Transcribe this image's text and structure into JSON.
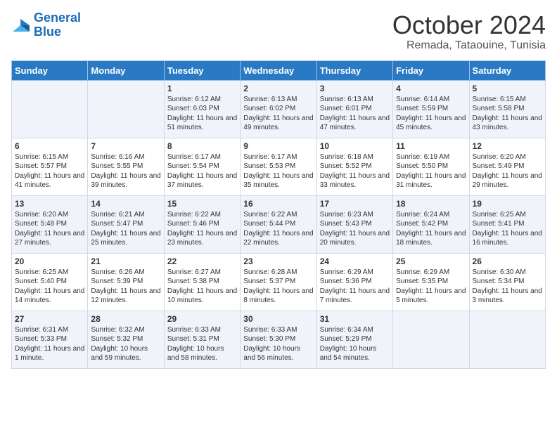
{
  "header": {
    "logo_line1": "General",
    "logo_line2": "Blue",
    "month": "October 2024",
    "location": "Remada, Tataouine, Tunisia"
  },
  "days_of_week": [
    "Sunday",
    "Monday",
    "Tuesday",
    "Wednesday",
    "Thursday",
    "Friday",
    "Saturday"
  ],
  "weeks": [
    [
      {
        "day": "",
        "content": ""
      },
      {
        "day": "",
        "content": ""
      },
      {
        "day": "1",
        "content": "Sunrise: 6:12 AM\nSunset: 6:03 PM\nDaylight: 11 hours and 51 minutes."
      },
      {
        "day": "2",
        "content": "Sunrise: 6:13 AM\nSunset: 6:02 PM\nDaylight: 11 hours and 49 minutes."
      },
      {
        "day": "3",
        "content": "Sunrise: 6:13 AM\nSunset: 6:01 PM\nDaylight: 11 hours and 47 minutes."
      },
      {
        "day": "4",
        "content": "Sunrise: 6:14 AM\nSunset: 5:59 PM\nDaylight: 11 hours and 45 minutes."
      },
      {
        "day": "5",
        "content": "Sunrise: 6:15 AM\nSunset: 5:58 PM\nDaylight: 11 hours and 43 minutes."
      }
    ],
    [
      {
        "day": "6",
        "content": "Sunrise: 6:15 AM\nSunset: 5:57 PM\nDaylight: 11 hours and 41 minutes."
      },
      {
        "day": "7",
        "content": "Sunrise: 6:16 AM\nSunset: 5:55 PM\nDaylight: 11 hours and 39 minutes."
      },
      {
        "day": "8",
        "content": "Sunrise: 6:17 AM\nSunset: 5:54 PM\nDaylight: 11 hours and 37 minutes."
      },
      {
        "day": "9",
        "content": "Sunrise: 6:17 AM\nSunset: 5:53 PM\nDaylight: 11 hours and 35 minutes."
      },
      {
        "day": "10",
        "content": "Sunrise: 6:18 AM\nSunset: 5:52 PM\nDaylight: 11 hours and 33 minutes."
      },
      {
        "day": "11",
        "content": "Sunrise: 6:19 AM\nSunset: 5:50 PM\nDaylight: 11 hours and 31 minutes."
      },
      {
        "day": "12",
        "content": "Sunrise: 6:20 AM\nSunset: 5:49 PM\nDaylight: 11 hours and 29 minutes."
      }
    ],
    [
      {
        "day": "13",
        "content": "Sunrise: 6:20 AM\nSunset: 5:48 PM\nDaylight: 11 hours and 27 minutes."
      },
      {
        "day": "14",
        "content": "Sunrise: 6:21 AM\nSunset: 5:47 PM\nDaylight: 11 hours and 25 minutes."
      },
      {
        "day": "15",
        "content": "Sunrise: 6:22 AM\nSunset: 5:46 PM\nDaylight: 11 hours and 23 minutes."
      },
      {
        "day": "16",
        "content": "Sunrise: 6:22 AM\nSunset: 5:44 PM\nDaylight: 11 hours and 22 minutes."
      },
      {
        "day": "17",
        "content": "Sunrise: 6:23 AM\nSunset: 5:43 PM\nDaylight: 11 hours and 20 minutes."
      },
      {
        "day": "18",
        "content": "Sunrise: 6:24 AM\nSunset: 5:42 PM\nDaylight: 11 hours and 18 minutes."
      },
      {
        "day": "19",
        "content": "Sunrise: 6:25 AM\nSunset: 5:41 PM\nDaylight: 11 hours and 16 minutes."
      }
    ],
    [
      {
        "day": "20",
        "content": "Sunrise: 6:25 AM\nSunset: 5:40 PM\nDaylight: 11 hours and 14 minutes."
      },
      {
        "day": "21",
        "content": "Sunrise: 6:26 AM\nSunset: 5:39 PM\nDaylight: 11 hours and 12 minutes."
      },
      {
        "day": "22",
        "content": "Sunrise: 6:27 AM\nSunset: 5:38 PM\nDaylight: 11 hours and 10 minutes."
      },
      {
        "day": "23",
        "content": "Sunrise: 6:28 AM\nSunset: 5:37 PM\nDaylight: 11 hours and 8 minutes."
      },
      {
        "day": "24",
        "content": "Sunrise: 6:29 AM\nSunset: 5:36 PM\nDaylight: 11 hours and 7 minutes."
      },
      {
        "day": "25",
        "content": "Sunrise: 6:29 AM\nSunset: 5:35 PM\nDaylight: 11 hours and 5 minutes."
      },
      {
        "day": "26",
        "content": "Sunrise: 6:30 AM\nSunset: 5:34 PM\nDaylight: 11 hours and 3 minutes."
      }
    ],
    [
      {
        "day": "27",
        "content": "Sunrise: 6:31 AM\nSunset: 5:33 PM\nDaylight: 11 hours and 1 minute."
      },
      {
        "day": "28",
        "content": "Sunrise: 6:32 AM\nSunset: 5:32 PM\nDaylight: 10 hours and 59 minutes."
      },
      {
        "day": "29",
        "content": "Sunrise: 6:33 AM\nSunset: 5:31 PM\nDaylight: 10 hours and 58 minutes."
      },
      {
        "day": "30",
        "content": "Sunrise: 6:33 AM\nSunset: 5:30 PM\nDaylight: 10 hours and 56 minutes."
      },
      {
        "day": "31",
        "content": "Sunrise: 6:34 AM\nSunset: 5:29 PM\nDaylight: 10 hours and 54 minutes."
      },
      {
        "day": "",
        "content": ""
      },
      {
        "day": "",
        "content": ""
      }
    ]
  ]
}
